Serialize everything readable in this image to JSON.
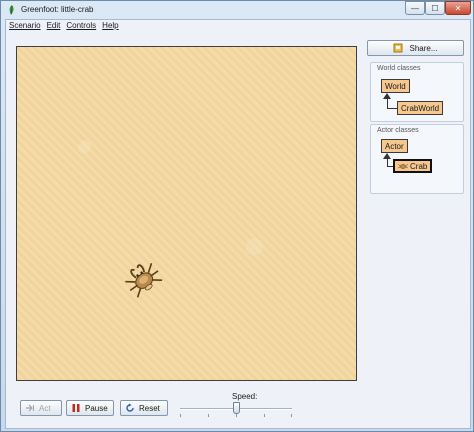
{
  "window": {
    "title": "Greenfoot: little-crab",
    "controls": {
      "minimize": "—",
      "maximize": "☐",
      "close": "✕"
    }
  },
  "menubar": {
    "items": [
      "Scenario",
      "Edit",
      "Controls",
      "Help"
    ]
  },
  "share": {
    "label": "Share..."
  },
  "classes": {
    "world_group_label": "World classes",
    "world_base": "World",
    "world_sub": "CrabWorld",
    "actor_group_label": "Actor classes",
    "actor_base": "Actor",
    "actor_sub": "Crab"
  },
  "controls": {
    "act_label": "Act",
    "pause_label": "Pause",
    "reset_label": "Reset",
    "speed_label": "Speed:",
    "speed_value": 0.5
  },
  "colors": {
    "world_bg": "#f3d9a4",
    "class_box": "#f6c88f",
    "pause_red": "#c0281e",
    "reset_blue": "#2e5fa8"
  },
  "icons": {
    "app": "greenfoot-leaf-icon",
    "share": "share-icon",
    "act": "act-step-icon",
    "pause": "pause-icon",
    "reset": "reset-icon",
    "crab": "crab-icon"
  }
}
